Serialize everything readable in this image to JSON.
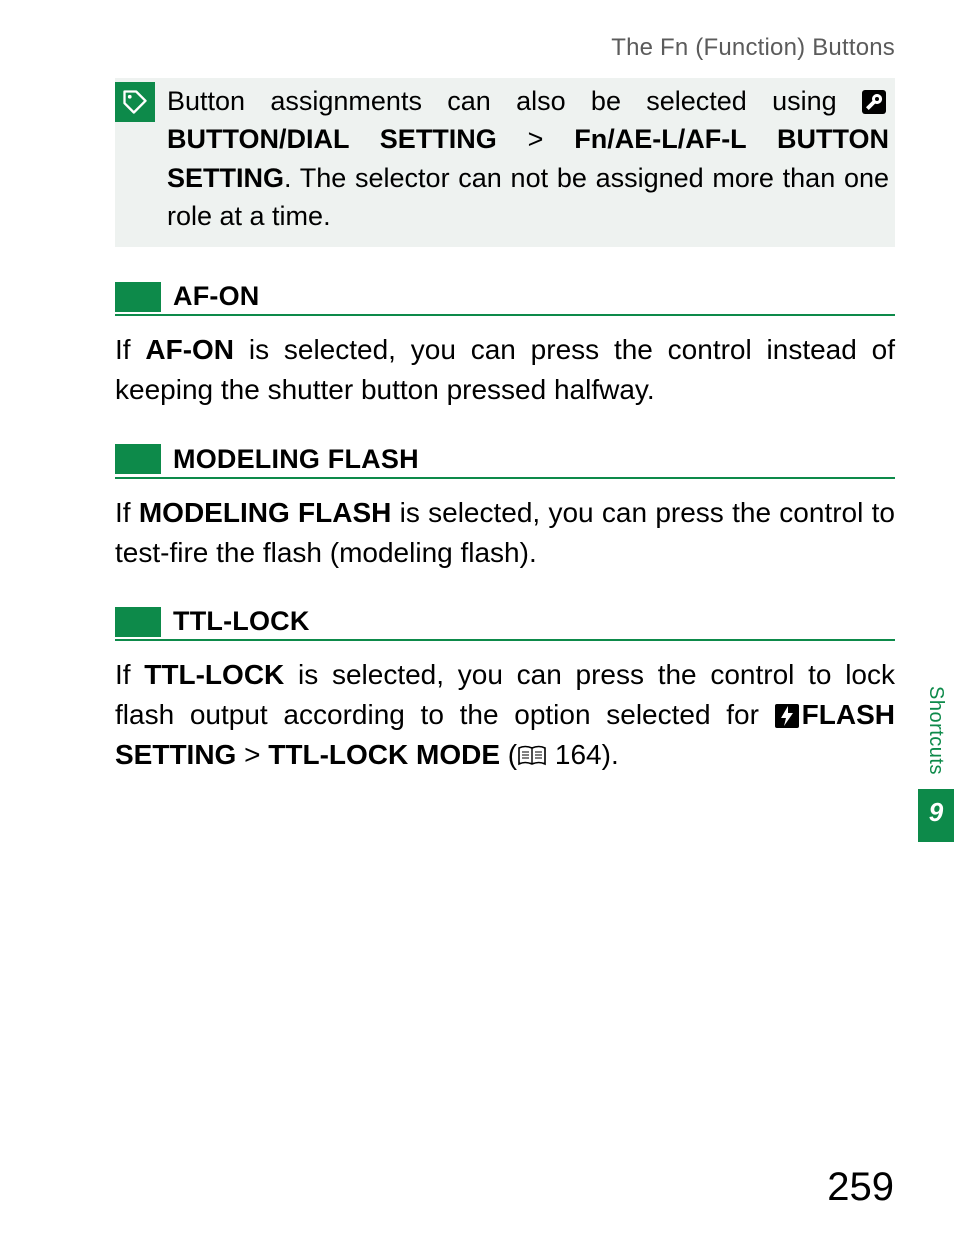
{
  "header": {
    "running": "The Fn (Function) Buttons"
  },
  "note": {
    "pre": "Button assignments can also be selected using ",
    "path1": "BUTTON/DIAL SETTING",
    "sep": ">",
    "path2": "Fn/AE-L/AF-L BUTTON SETTING",
    "post": ". The selector can not be assigned more than one role at a time."
  },
  "sections": {
    "afon": {
      "title": "AF-ON",
      "pre": "If ",
      "term": "AF-ON",
      "post": " is selected, you can press the control instead of keeping the shutter button pressed halfway."
    },
    "modeling": {
      "title": "MODELING FLASH",
      "pre": "If ",
      "term": "MODELING FLASH",
      "post": " is selected, you can press the control to test-fire the flash (modeling flash)."
    },
    "ttl": {
      "title": "TTL-LOCK",
      "pre": "If ",
      "term": "TTL-LOCK",
      "mid": " is selected, you can press the control to lock flash output according to the option selected for ",
      "path1": "FLASH SETTING",
      "sep": ">",
      "path2": "TTL-LOCK MODE",
      "pageref_open": " (",
      "pageref_num": "164",
      "pageref_close": ")."
    }
  },
  "side": {
    "label": "Shortcuts",
    "chapter": "9"
  },
  "footer": {
    "page": "259"
  }
}
